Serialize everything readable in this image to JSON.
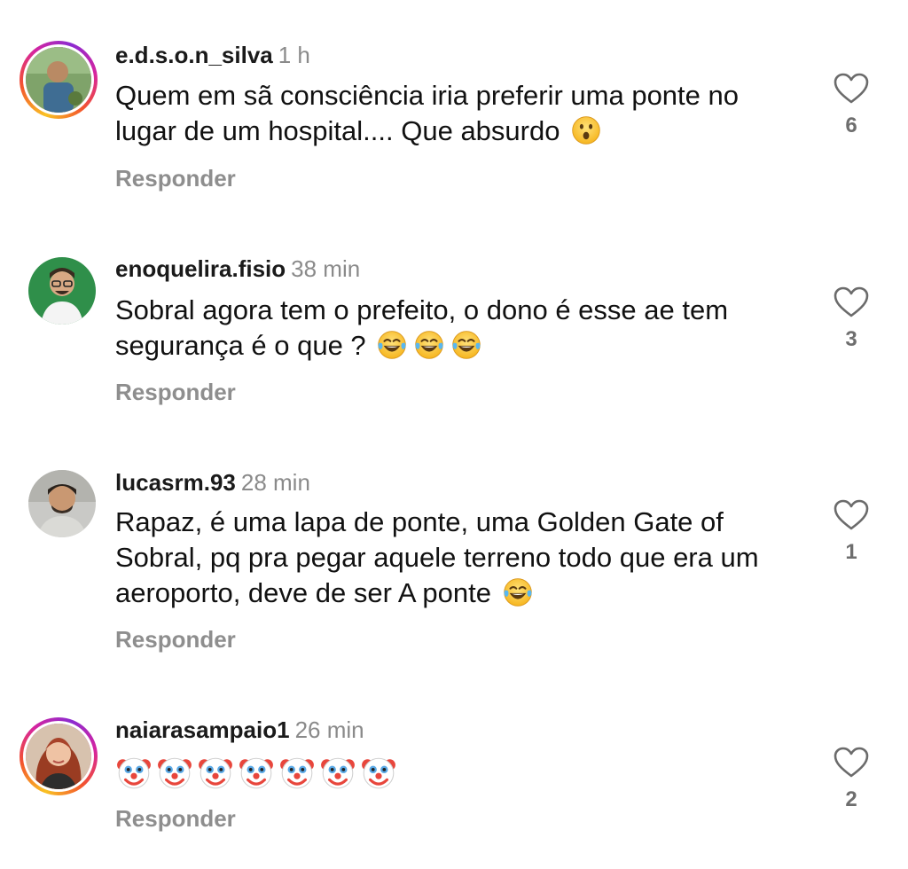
{
  "comments": [
    {
      "username": "e.d.s.o.n_silva",
      "time": "1 h",
      "text": "Quem em sã consciência iria preferir uma ponte no lugar de um hospital.... Que absurdo",
      "emoji_icons": [
        "surprised-face-icon"
      ],
      "reply_label": "Responder",
      "likes": "6",
      "story_ring": true
    },
    {
      "username": "enoquelira.fisio",
      "time": "38 min",
      "text": "Sobral agora tem o prefeito, o dono é esse ae tem segurança é o que ?",
      "emoji_icons": [
        "tears-of-joy-icon",
        "tears-of-joy-icon",
        "tears-of-joy-icon"
      ],
      "reply_label": "Responder",
      "likes": "3",
      "story_ring": false
    },
    {
      "username": "lucasrm.93",
      "time": "28 min",
      "text": "Rapaz, é uma lapa de ponte, uma Golden Gate of Sobral, pq pra pegar aquele terreno todo que era um aeroporto, deve de ser A ponte",
      "emoji_icons": [
        "tears-of-joy-icon"
      ],
      "reply_label": "Responder",
      "likes": "1",
      "story_ring": false
    },
    {
      "username": "naiarasampaio1",
      "time": "26 min",
      "text": "",
      "emoji_icons": [
        "clown-face-icon",
        "clown-face-icon",
        "clown-face-icon",
        "clown-face-icon",
        "clown-face-icon",
        "clown-face-icon",
        "clown-face-icon"
      ],
      "reply_label": "Responder",
      "likes": "2",
      "story_ring": true
    }
  ],
  "colors": {
    "username": "#1a1a1a",
    "time": "#8a8a8a",
    "reply": "#8e8e8e",
    "like_count": "#6e6e6e",
    "story_ring_gradient": [
      "#f9c224",
      "#f3542d",
      "#d6249f",
      "#8b2bd1"
    ]
  },
  "icons": {
    "like": "heart-outline-icon"
  }
}
